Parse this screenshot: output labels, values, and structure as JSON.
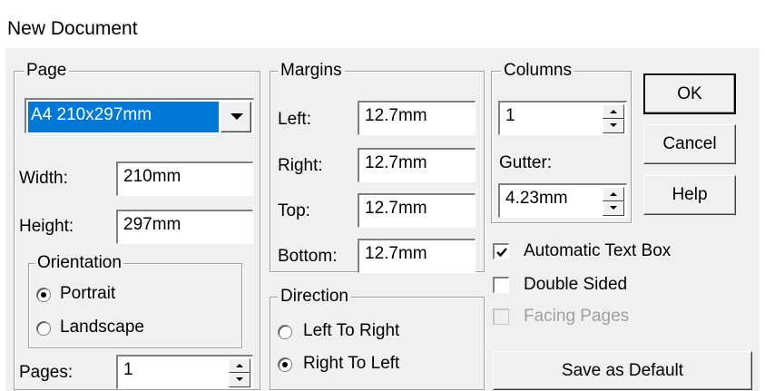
{
  "window": {
    "title": "New Document"
  },
  "page": {
    "legend": "Page",
    "size_selected": "A4 210x297mm",
    "width_label": "Width:",
    "width_value": "210mm",
    "height_label": "Height:",
    "height_value": "297mm",
    "orientation": {
      "legend": "Orientation",
      "portrait_label": "Portrait",
      "landscape_label": "Landscape",
      "selected": "Portrait"
    },
    "pages_label": "Pages:",
    "pages_value": "1"
  },
  "margins": {
    "legend": "Margins",
    "left_label": "Left:",
    "left_value": "12.7mm",
    "right_label": "Right:",
    "right_value": "12.7mm",
    "top_label": "Top:",
    "top_value": "12.7mm",
    "bottom_label": "Bottom:",
    "bottom_value": "12.7mm"
  },
  "direction": {
    "legend": "Direction",
    "ltr_label": "Left To Right",
    "rtl_label": "Right To Left",
    "selected": "Right To Left"
  },
  "columns": {
    "legend": "Columns",
    "count_value": "1",
    "gutter_label": "Gutter:",
    "gutter_value": "4.23mm"
  },
  "buttons": {
    "ok": "OK",
    "cancel": "Cancel",
    "help": "Help",
    "save_default": "Save as Default"
  },
  "options": {
    "auto_text_box": {
      "label": "Automatic Text Box",
      "checked": true
    },
    "double_sided": {
      "label": "Double Sided",
      "checked": false
    },
    "facing_pages": {
      "label": "Facing Pages",
      "checked": false,
      "disabled": true
    }
  },
  "colors": {
    "dialog_bg": "#f0f0f0",
    "selection": "#0078d7",
    "disabled_text": "#a0a0a0"
  }
}
